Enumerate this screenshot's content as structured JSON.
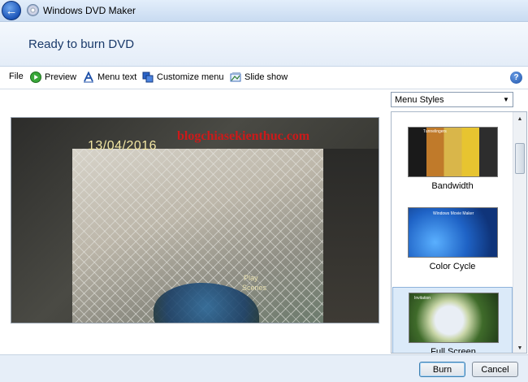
{
  "window": {
    "title": "Windows DVD Maker",
    "back_icon": "back-arrow-icon",
    "app_icon": "dvd-disc-icon"
  },
  "header": {
    "title": "Ready to burn DVD"
  },
  "toolbar": {
    "file_label": "File",
    "preview_label": "Preview",
    "menu_text_label": "Menu text",
    "customize_menu_label": "Customize menu",
    "slide_show_label": "Slide show",
    "help_icon": "help-icon"
  },
  "preview": {
    "date_text": "13/04/2016",
    "watermark": "blogchiasekienthuc.com",
    "play_text": "Play",
    "scenes_text": "Scenes"
  },
  "menu_styles": {
    "selected": "Menu Styles",
    "items": [
      {
        "label": "Bandwidth",
        "thumb_title": "Tunnelingers",
        "selected": false
      },
      {
        "label": "Color Cycle",
        "thumb_title": "Windows Movie Maker",
        "selected": false
      },
      {
        "label": "Full Screen",
        "thumb_title": "Invitation",
        "selected": true
      }
    ]
  },
  "footer": {
    "burn_label": "Burn",
    "cancel_label": "Cancel"
  },
  "colors": {
    "accent": "#1c55b8",
    "watermark": "#cc1a1a",
    "selected_item": "#dbeaf9"
  }
}
